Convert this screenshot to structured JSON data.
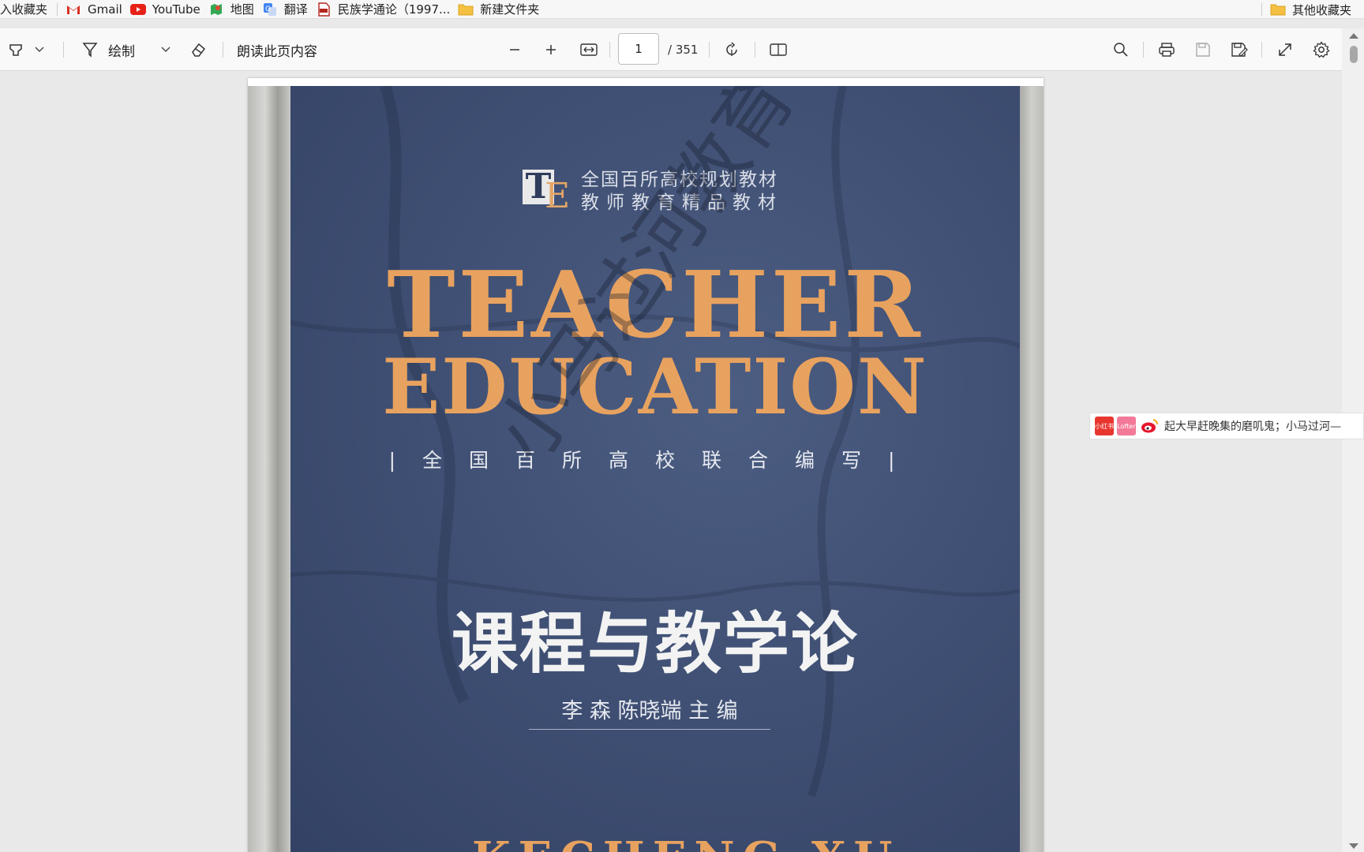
{
  "bookmarks": {
    "items": [
      {
        "label": "入收藏夹",
        "icon": "none"
      },
      {
        "label": "Gmail",
        "icon": "gmail-icon"
      },
      {
        "label": "YouTube",
        "icon": "youtube-icon"
      },
      {
        "label": "地图",
        "icon": "maps-icon"
      },
      {
        "label": "翻译",
        "icon": "translate-icon"
      },
      {
        "label": "民族学通论（1997...",
        "icon": "pdf-icon"
      },
      {
        "label": "新建文件夹",
        "icon": "folder-icon"
      }
    ],
    "other": "其他收藏夹"
  },
  "toolbar": {
    "draw_label": "绘制",
    "read_aloud_label": "朗读此页内容",
    "page_current": "1",
    "page_total": "/ 351"
  },
  "cover": {
    "series_line1": "全国百所高校规划教材",
    "series_line2": "教师教育精品教材",
    "title_en_1": "TEACHER",
    "title_en_2": "EDUCATION",
    "joint_line": "|全国百所高校联合编写|",
    "title_cn": "课程与教学论",
    "editors": "李 森  陈晓端  主 编",
    "bottom_partial": "KECHENG XU",
    "watermark": "小马过河教育"
  },
  "banner": {
    "app1": "小红书",
    "app2": "Lofter",
    "message": "起大早赶晚集的磨叽鬼；小马过河—"
  },
  "colors": {
    "cover_blue": "#3e4e72",
    "title_orange": "#e8a25f",
    "toolbar_bg": "#f9f9f9"
  }
}
